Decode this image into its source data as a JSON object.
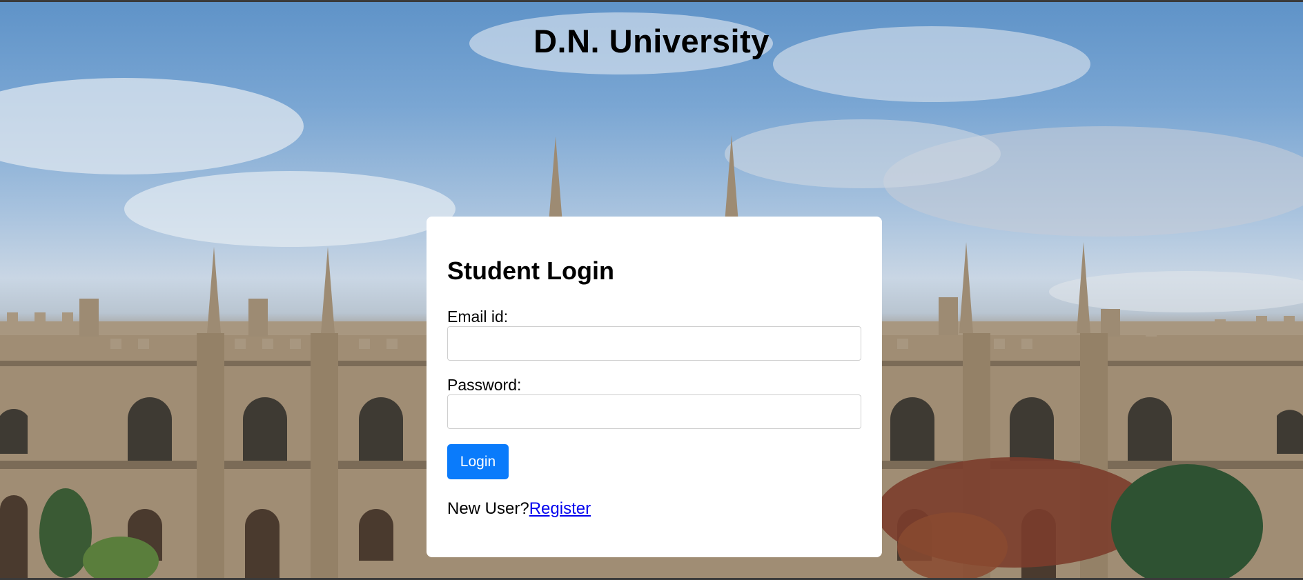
{
  "site": {
    "title": "D.N. University"
  },
  "login": {
    "heading": "Student Login",
    "email_label": "Email id:",
    "email_value": "",
    "email_placeholder": "",
    "password_label": "Password:",
    "password_value": "",
    "password_placeholder": "",
    "submit_label": "Login",
    "new_user_text": "New User?",
    "register_link": "Register"
  },
  "colors": {
    "button_bg": "#0a7bfb",
    "link": "#0000ee",
    "card_bg": "#ffffff"
  },
  "background": {
    "image": "university-building-photo"
  }
}
